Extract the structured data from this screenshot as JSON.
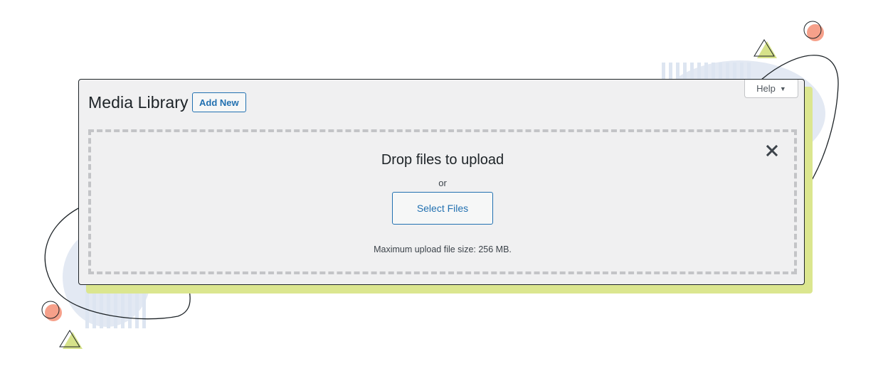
{
  "page": {
    "title": "Media Library",
    "add_new_label": "Add New",
    "help_label": "Help",
    "help_icon": "caret-down-icon"
  },
  "uploader": {
    "heading": "Drop files to upload",
    "or_text": "or",
    "select_files_label": "Select Files",
    "max_size_text": "Maximum upload file size: 256 MB.",
    "close_icon": "close-icon"
  },
  "colors": {
    "accent": "#2271b1",
    "panel_bg": "#f0f0f1",
    "shadow_green": "#dbe68f",
    "deco_blue": "#dde5f1",
    "deco_coral": "#f6a08a"
  }
}
